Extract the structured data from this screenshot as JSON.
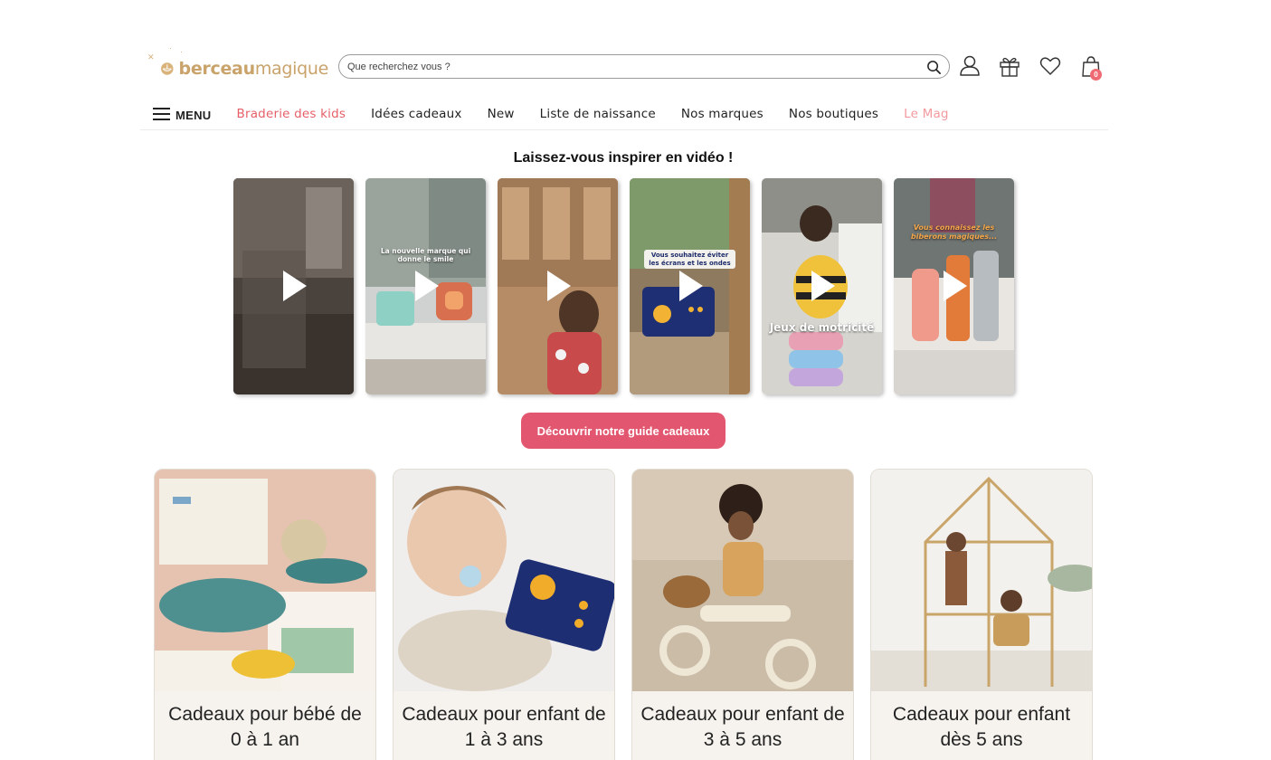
{
  "brand": {
    "name_regular": "berceau",
    "name_light": "magique"
  },
  "search": {
    "placeholder": "Que recherchez vous ?"
  },
  "header_icons": [
    "user-icon",
    "gift-icon",
    "heart-icon",
    "shopping-bag-icon"
  ],
  "cart": {
    "count": "0"
  },
  "nav": {
    "menu_label": "MENU",
    "links": [
      {
        "label": "Braderie des kids",
        "color": "#e65f68"
      },
      {
        "label": "Idées cadeaux"
      },
      {
        "label": "New"
      },
      {
        "label": "Liste de naissance"
      },
      {
        "label": "Nos marques"
      },
      {
        "label": "Nos boutiques"
      },
      {
        "label": "Le Mag",
        "color": "#f39a9f"
      }
    ]
  },
  "videos_section": {
    "title": "Laissez-vous inspirer en vidéo !",
    "videos": [
      {
        "caption": ""
      },
      {
        "caption": "La nouvelle marque qui donne le smile"
      },
      {
        "caption": ""
      },
      {
        "caption": "Vous souhaitez éviter les écrans et les ondes"
      },
      {
        "caption": "Jeux de motricité"
      },
      {
        "caption": "Vous connaissez les biberons magiques..."
      }
    ]
  },
  "cta": {
    "label": "Découvrir notre guide cadeaux",
    "color": "#e3566f"
  },
  "gift_cards": [
    {
      "title": "Cadeaux pour bébé de 0 à 1 an"
    },
    {
      "title": "Cadeaux pour enfant de 1 à 3 ans"
    },
    {
      "title": "Cadeaux pour enfant de 3 à 5 ans"
    },
    {
      "title": "Cadeaux pour enfant dès 5 ans"
    }
  ]
}
